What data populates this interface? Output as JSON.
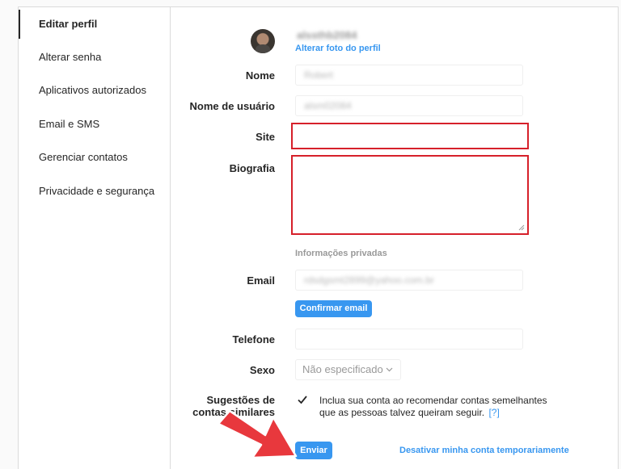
{
  "sidebar": {
    "items": [
      {
        "label": "Editar perfil",
        "active": true
      },
      {
        "label": "Alterar senha"
      },
      {
        "label": "Aplicativos autorizados"
      },
      {
        "label": "Email e SMS"
      },
      {
        "label": "Gerenciar contatos"
      },
      {
        "label": "Privacidade e segurança"
      }
    ]
  },
  "profile": {
    "username_display": "alssthb2084",
    "change_photo_label": "Alterar foto do perfil"
  },
  "form": {
    "name_label": "Nome",
    "name_value": "Robert",
    "username_label": "Nome de usuário",
    "username_value": "alsm02084",
    "site_label": "Site",
    "site_value": "",
    "bio_label": "Biografia",
    "bio_value": "",
    "private_info_heading": "Informações privadas",
    "email_label": "Email",
    "email_value": "rdsdgsmt2899@yahoo.com.br",
    "confirm_email_label": "Confirmar email",
    "phone_label": "Telefone",
    "phone_value": "",
    "gender_label": "Sexo",
    "gender_value": "Não especificado",
    "suggestions_label_line1": "Sugestões de",
    "suggestions_label_line2": "contas similares",
    "suggestions_checked": true,
    "suggestions_text_line1": "Inclua sua conta ao recomendar contas semelhantes",
    "suggestions_text_line2": "que as pessoas talvez queiram seguir.",
    "suggestions_help": "[?]",
    "submit_label": "Enviar",
    "deactivate_label": "Desativar minha conta temporariamente"
  },
  "colors": {
    "accent": "#3897f0",
    "highlight": "#d6202a",
    "annotation_arrow": "#e8383d"
  },
  "icons": {
    "checkbox": "checkmark-icon",
    "dropdown": "chevron-down-icon",
    "resize": "resize-grip-icon",
    "annotation": "arrow-icon"
  }
}
